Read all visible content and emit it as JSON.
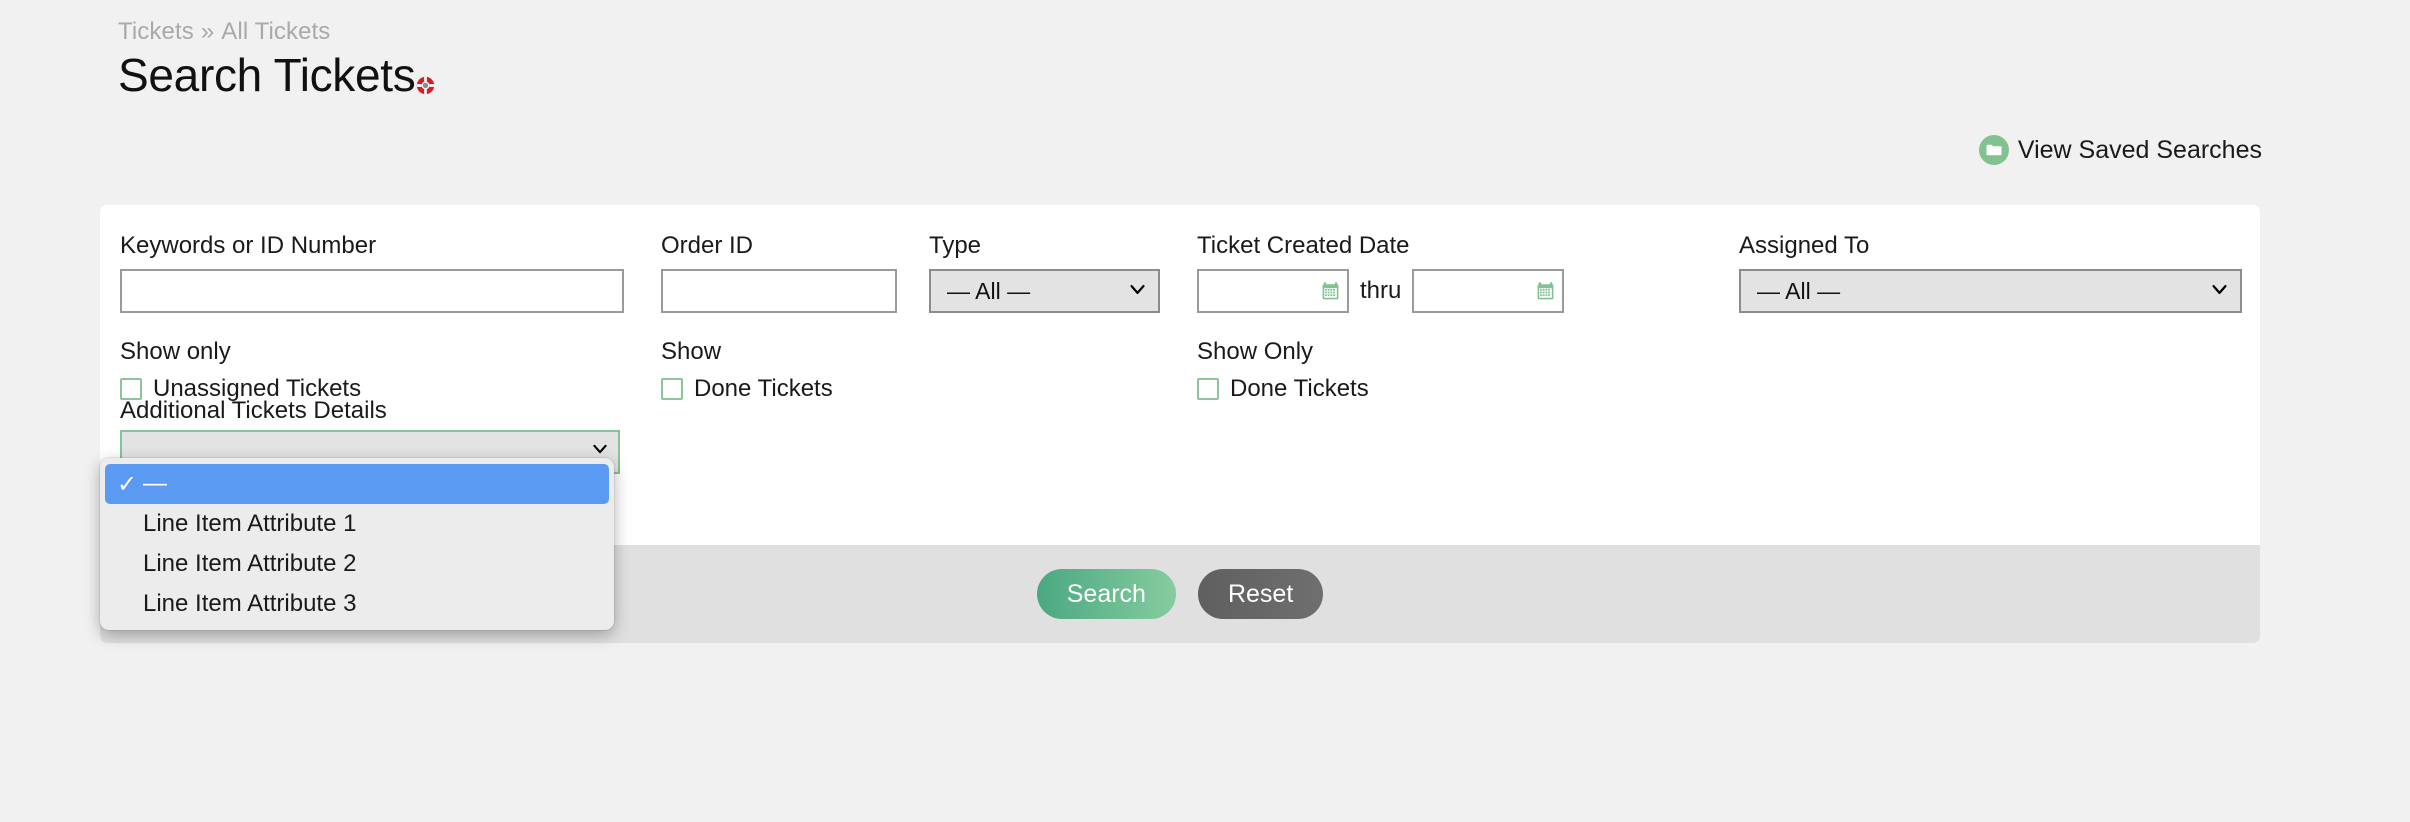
{
  "breadcrumb": {
    "parent": "Tickets",
    "separator": "»",
    "current": "All Tickets"
  },
  "header": {
    "title": "Search Tickets",
    "help_icon": "lifebuoy-icon"
  },
  "saved_searches": {
    "label": "View Saved Searches",
    "icon": "folder-icon",
    "icon_color": "#84c191"
  },
  "form": {
    "keywords": {
      "label": "Keywords or ID Number",
      "value": "",
      "placeholder": ""
    },
    "order_id": {
      "label": "Order ID",
      "value": "",
      "placeholder": ""
    },
    "type": {
      "label": "Type",
      "selected": "— All —"
    },
    "created_date": {
      "label": "Ticket Created Date",
      "from_value": "",
      "to_value": "",
      "thru_label": "thru",
      "calendar_icon": "calendar-icon",
      "calendar_icon_color": "#84c191"
    },
    "assigned_to": {
      "label": "Assigned To",
      "selected": "— All —"
    },
    "unassigned": {
      "group_label": "Show only",
      "checkbox_label": "Unassigned Tickets",
      "checked": false
    },
    "done_show": {
      "group_label": "Show",
      "checkbox_label": "Done Tickets",
      "checked": false
    },
    "done_only": {
      "group_label": "Show Only",
      "checkbox_label": "Done Tickets",
      "checked": false
    },
    "additional_details": {
      "label": "Additional Tickets Details",
      "selected": "—",
      "open": true,
      "options": [
        {
          "label": "—",
          "selected": true
        },
        {
          "label": "Line Item Attribute 1",
          "selected": false
        },
        {
          "label": "Line Item Attribute 2",
          "selected": false
        },
        {
          "label": "Line Item Attribute 3",
          "selected": false
        }
      ]
    }
  },
  "actions": {
    "search_label": "Search",
    "reset_label": "Reset"
  },
  "colors": {
    "accent_green": "#84c191",
    "highlight_blue": "#5b9af2",
    "page_bg": "#f1f1f1",
    "panel_bg": "#ffffff",
    "footer_bg": "#e0e0e0"
  },
  "glyphs": {
    "chevron_down": "⌄",
    "check": "✓"
  }
}
